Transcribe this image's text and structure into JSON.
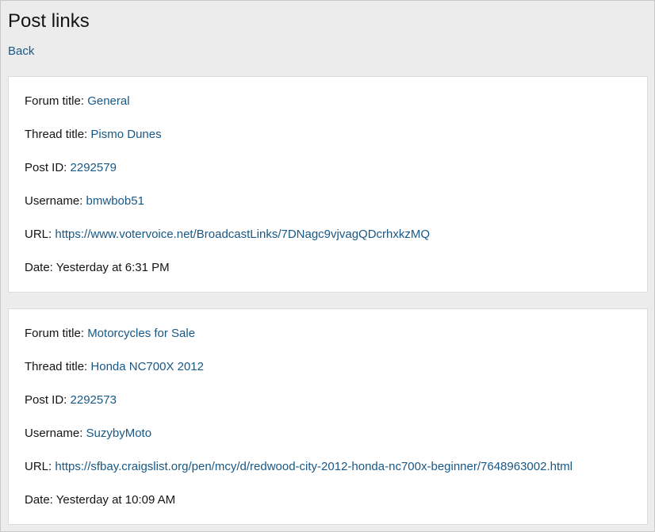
{
  "page": {
    "title": "Post links",
    "back_label": "Back"
  },
  "labels": {
    "forum_title": "Forum title:",
    "thread_title": "Thread title:",
    "post_id": "Post ID:",
    "username": "Username:",
    "url": "URL:",
    "date": "Date:"
  },
  "posts": [
    {
      "forum_title": "General",
      "thread_title": "Pismo Dunes",
      "post_id": "2292579",
      "username": "bmwbob51",
      "url": "https://www.votervoice.net/BroadcastLinks/7DNagc9vjvagQDcrhxkzMQ",
      "date": "Yesterday at 6:31 PM"
    },
    {
      "forum_title": "Motorcycles for Sale",
      "thread_title": "Honda NC700X 2012",
      "post_id": "2292573",
      "username": "SuzybyMoto",
      "url": "https://sfbay.craigslist.org/pen/mcy/d/redwood-city-2012-honda-nc700x-beginner/7648963002.html",
      "date": "Yesterday at 10:09 AM"
    }
  ]
}
